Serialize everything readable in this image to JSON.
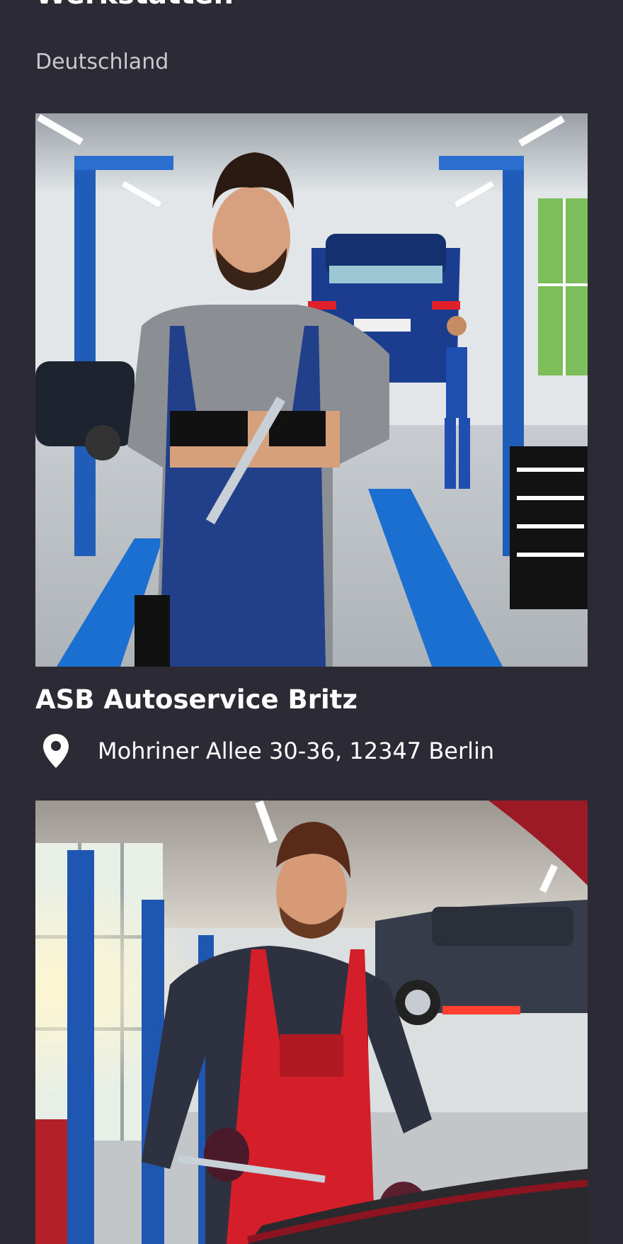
{
  "page": {
    "title": "Werkstätten",
    "subtitle": "Deutschland"
  },
  "cards": [
    {
      "name": "ASB Autoservice Britz",
      "address": "Mohriner Allee 30-36, 12347 Berlin",
      "address_icon": "map-pin-icon",
      "image_description": "mechanic-blue-overalls-photo"
    },
    {
      "image_description": "mechanic-red-overalls-photo"
    }
  ],
  "colors": {
    "background": "#2b2a35",
    "text": "#ffffff",
    "subtitle": "#c9c9cf"
  }
}
